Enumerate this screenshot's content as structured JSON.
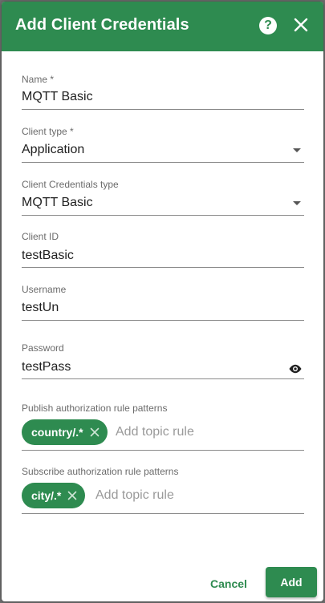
{
  "dialog": {
    "title": "Add Client Credentials",
    "help_icon": "question-circle-icon",
    "close_icon": "close-icon"
  },
  "fields": {
    "name": {
      "label": "Name *",
      "value": "MQTT Basic"
    },
    "client_type": {
      "label": "Client type *",
      "value": "Application"
    },
    "credentials_type": {
      "label": "Client Credentials type",
      "value": "MQTT Basic"
    },
    "client_id": {
      "label": "Client ID",
      "value": "testBasic"
    },
    "username": {
      "label": "Username",
      "value": "testUn"
    },
    "password": {
      "label": "Password",
      "value": "testPass",
      "icon": "eye-icon"
    }
  },
  "publish_rules": {
    "label": "Publish authorization rule patterns",
    "chips": [
      "country/.*"
    ],
    "placeholder": "Add topic rule"
  },
  "subscribe_rules": {
    "label": "Subscribe authorization rule patterns",
    "chips": [
      "city/.*"
    ],
    "placeholder": "Add topic rule"
  },
  "actions": {
    "cancel_label": "Cancel",
    "add_label": "Add"
  },
  "colors": {
    "primary": "#2e8b50",
    "backdrop": "#6f6f6f"
  }
}
